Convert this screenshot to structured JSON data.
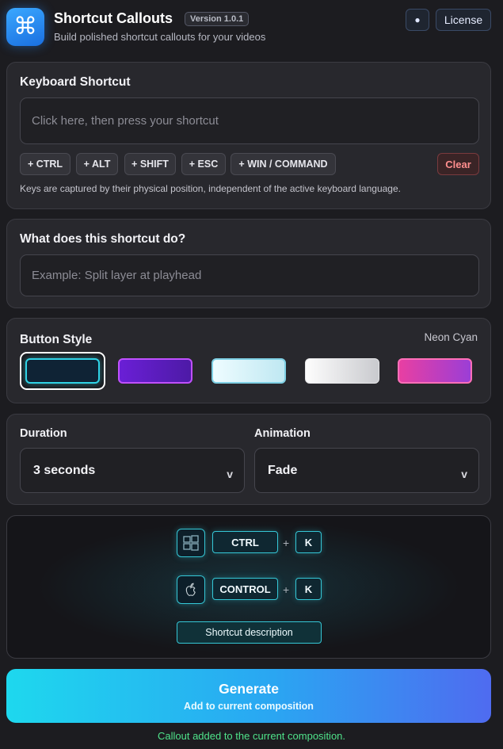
{
  "header": {
    "title": "Shortcut Callouts",
    "version": "Version 1.0.1",
    "subtitle": "Build polished shortcut callouts for your videos",
    "dot_button": "●",
    "license_button": "License",
    "app_icon_glyph": "⌘"
  },
  "keyboard_shortcut": {
    "title": "Keyboard Shortcut",
    "placeholder": "Click here, then press your shortcut",
    "modifiers": [
      "+ CTRL",
      "+ ALT",
      "+ SHIFT",
      "+ ESC",
      "+ WIN / COMMAND"
    ],
    "clear_label": "Clear",
    "help_text": "Keys are captured by their physical position, independent of the active keyboard language."
  },
  "description": {
    "title": "What does this shortcut do?",
    "placeholder": "Example: Split layer at playhead"
  },
  "button_style": {
    "title": "Button Style",
    "selected_label": "Neon Cyan",
    "selected_index": 0,
    "styles": [
      "neon-cyan",
      "purple",
      "light-cyan",
      "silver",
      "pink"
    ]
  },
  "settings": {
    "duration_label": "Duration",
    "duration_value": "3 seconds",
    "animation_label": "Animation",
    "animation_value": "Fade",
    "chevron": "v"
  },
  "preview": {
    "windows_row": {
      "os_icon": "windows-icon",
      "modifier": "CTRL",
      "plus": "+",
      "key": "K"
    },
    "mac_row": {
      "os_icon": "apple-icon",
      "modifier": "CONTROL",
      "plus": "+",
      "key": "K"
    },
    "description_placeholder": "Shortcut description"
  },
  "generate": {
    "title": "Generate",
    "subtitle": "Add to current composition"
  },
  "status": "Callout added to the current composition.",
  "colors": {
    "accent_cyan": "#35c7d6",
    "status_green": "#4fe38a",
    "clear_red": "#ff8e8e"
  }
}
